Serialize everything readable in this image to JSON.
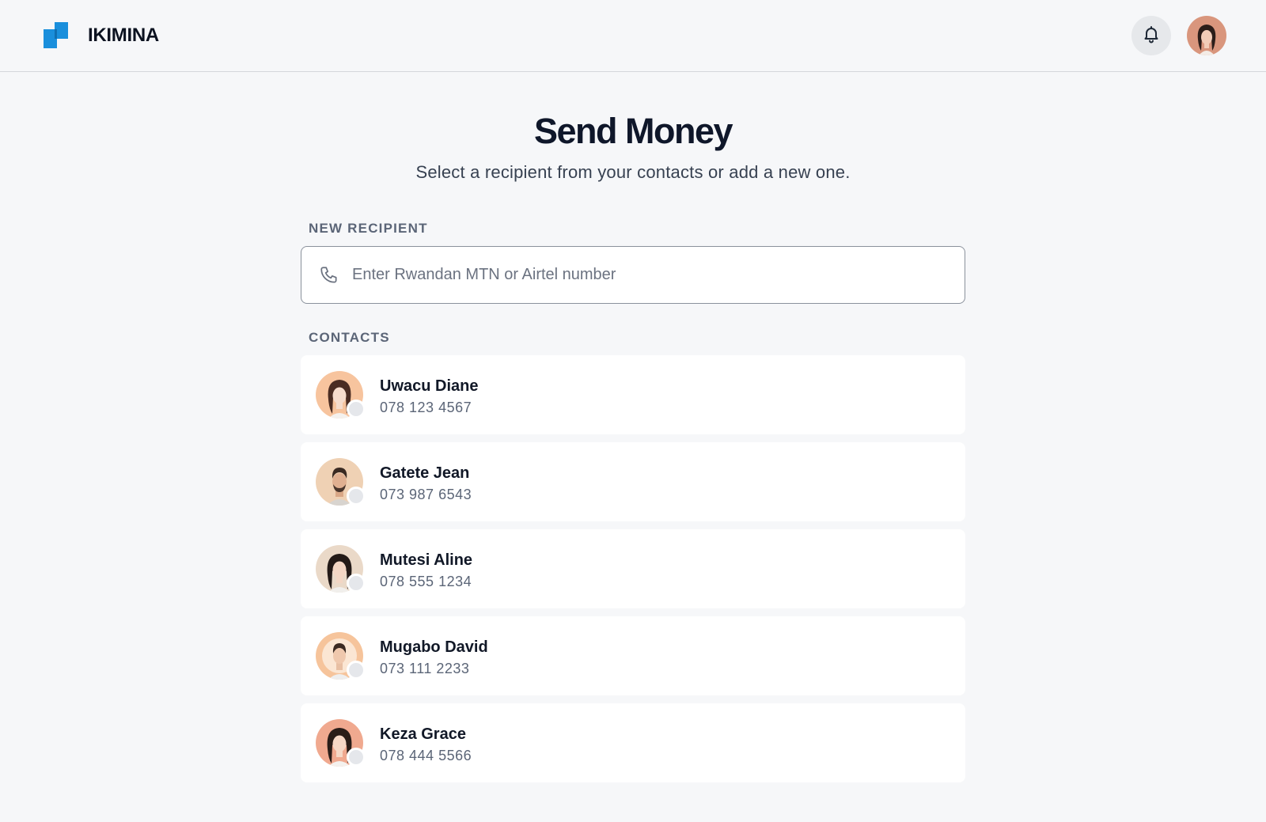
{
  "header": {
    "brand_name": "IKIMINA",
    "icons": {
      "logo": "logo-icon",
      "notifications": "bell-icon",
      "profile": "avatar"
    }
  },
  "main": {
    "title": "Send Money",
    "subtitle": "Select a recipient from your contacts or add a new one.",
    "new_recipient": {
      "label": "NEW RECIPIENT",
      "placeholder": "Enter Rwandan MTN or Airtel number",
      "value": ""
    },
    "contacts_label": "CONTACTS",
    "contacts": [
      {
        "name": "Uwacu Diane",
        "phone": "078 123 4567"
      },
      {
        "name": "Gatete Jean",
        "phone": "073 987 6543"
      },
      {
        "name": "Mutesi Aline",
        "phone": "078 555 1234"
      },
      {
        "name": "Mugabo David",
        "phone": "073 111 2233"
      },
      {
        "name": "Keza Grace",
        "phone": "078 444 5566"
      }
    ]
  },
  "colors": {
    "brand": "#1a8fdc",
    "background": "#f6f7f9",
    "text_primary": "#111827",
    "text_muted": "#5b6577"
  }
}
